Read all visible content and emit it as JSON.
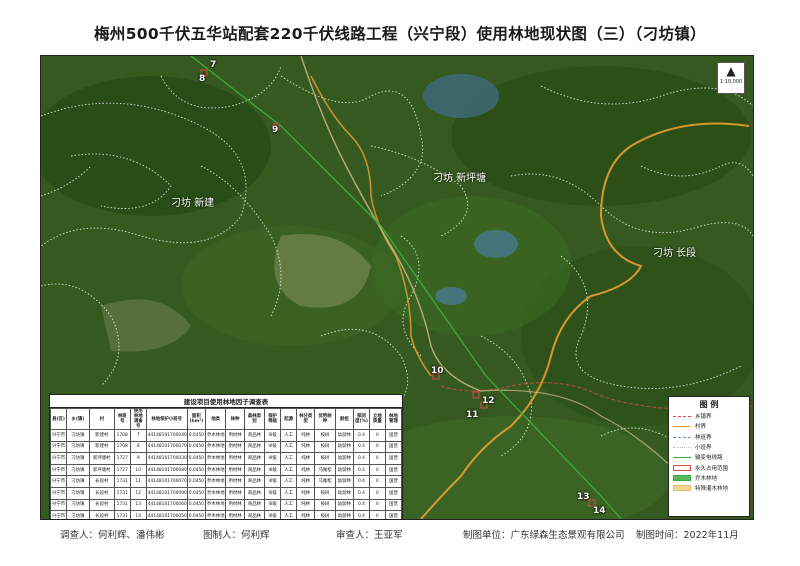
{
  "title": "梅州500千伏五华站配套220千伏线路工程（兴宁段）使用林地现状图（三）（刁坊镇）",
  "north_arrow": {
    "letter": "N",
    "scale": "1:10,000"
  },
  "places": [
    {
      "name": "刁坊 新建"
    },
    {
      "name": "刁坊 新坪塘"
    },
    {
      "name": "刁坊 长段"
    }
  ],
  "tower_markers": [
    "7",
    "8",
    "9",
    "10",
    "11",
    "12",
    "13",
    "14"
  ],
  "survey": {
    "caption": "建设项目使用林地因子调查表",
    "headers": [
      "县(区)",
      "乡(镇)",
      "村",
      "林班号",
      "使用林地调查号",
      "林地保护小班号",
      "面积(hm²)",
      "地类",
      "林种",
      "森林类别",
      "保护等级",
      "起源",
      "林分类型",
      "优势树种",
      "龄组",
      "郁闭度(%)",
      "立地质量",
      "林地管理"
    ],
    "rows": [
      [
        "兴宁市",
        "刁坊镇",
        "新建村",
        "1708",
        "7",
        "441481017000400500",
        "0.0450",
        "乔木林地",
        "用材林",
        "商品林",
        "III级",
        "人工",
        "纯林",
        "桉树",
        "幼龄林",
        "0.4",
        "II",
        "国营"
      ],
      [
        "兴宁市",
        "刁坊镇",
        "新建村",
        "1708",
        "8",
        "441481017000700",
        "0.0450",
        "乔木林地",
        "用材林",
        "商品林",
        "III级",
        "人工",
        "纯林",
        "桉树",
        "幼龄林",
        "0.4",
        "II",
        "国营"
      ],
      [
        "兴宁市",
        "刁坊镇",
        "新坪塘村",
        "1727",
        "9",
        "441481017000300",
        "0.0450",
        "乔木林地",
        "用材林",
        "商品林",
        "III级",
        "人工",
        "纯林",
        "桉树",
        "幼龄林",
        "0.4",
        "II",
        "国营"
      ],
      [
        "兴宁市",
        "刁坊镇",
        "新坪塘村",
        "1727",
        "10",
        "441481017000800",
        "0.0450",
        "乔木林地",
        "用材林",
        "商品林",
        "III级",
        "人工",
        "纯林",
        "马尾松",
        "幼龄林",
        "0.4",
        "II",
        "国营"
      ],
      [
        "兴宁市",
        "刁坊镇",
        "长段村",
        "1731",
        "11",
        "441481017000700",
        "0.0450",
        "乔木林地",
        "用材林",
        "商品林",
        "III级",
        "人工",
        "纯林",
        "马尾松",
        "幼龄林",
        "0.4",
        "II",
        "国营"
      ],
      [
        "兴宁市",
        "刁坊镇",
        "长段村",
        "1731",
        "12",
        "441481017000900",
        "0.0450",
        "乔木林地",
        "用材林",
        "商品林",
        "III级",
        "人工",
        "纯林",
        "桉树",
        "幼龄林",
        "0.4",
        "II",
        "国营"
      ],
      [
        "兴宁市",
        "刁坊镇",
        "长段村",
        "1731",
        "13",
        "441481017000600",
        "0.0450",
        "乔木林地",
        "用材林",
        "商品林",
        "III级",
        "人工",
        "纯林",
        "桉树",
        "幼龄林",
        "0.4",
        "II",
        "国营"
      ],
      [
        "兴宁市",
        "刁坊镇",
        "长段村",
        "1731",
        "14",
        "441481017000500",
        "0.0450",
        "乔木林地",
        "用材林",
        "商品林",
        "III级",
        "人工",
        "纯林",
        "桉树",
        "幼龄林",
        "0.4",
        "II",
        "国营"
      ]
    ]
  },
  "legend": {
    "title": "图  例",
    "items": [
      {
        "label": "乡镇界",
        "kind": "line",
        "color": "#d94b4b",
        "style": "dashed"
      },
      {
        "label": "村界",
        "kind": "line",
        "color": "#e8a030",
        "style": "solid"
      },
      {
        "label": "林班界",
        "kind": "line",
        "color": "#5aa0d8",
        "style": "dashed"
      },
      {
        "label": "小班界",
        "kind": "line",
        "color": "#bbbbbb",
        "style": "dotted"
      },
      {
        "label": "输变电线路",
        "kind": "line",
        "color": "#3aa83a",
        "style": "solid"
      },
      {
        "label": "永久占用范围",
        "kind": "box",
        "color": "#d94b4b",
        "fill": "#ffffff"
      },
      {
        "label": "乔木林地",
        "kind": "box",
        "color": "#3aa83a",
        "fill": "#5cb85c"
      },
      {
        "label": "特殊灌木林地",
        "kind": "box",
        "color": "#e0c070",
        "fill": "#f0d890"
      }
    ]
  },
  "footer": {
    "surveyor": "调查人：何利辉、潘伟彬",
    "drafter": "图制人：何利辉",
    "reviewer": "审查人：王亚军",
    "unit": "制图单位：广东绿森生态景观有限公司",
    "date": "制图时间：2022年11月"
  }
}
